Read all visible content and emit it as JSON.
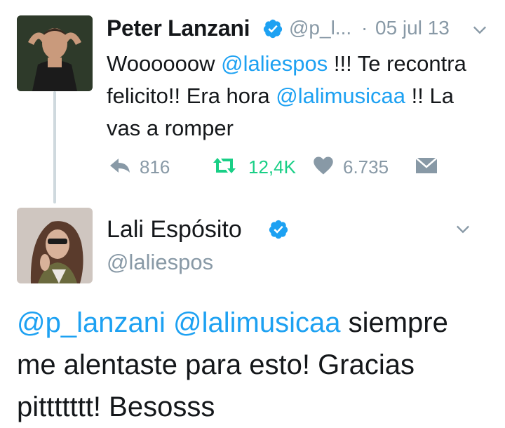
{
  "tweet1": {
    "name": "Peter Lanzani",
    "handle": "@p_l...",
    "separator": "·",
    "date": "05 jul 13",
    "text": {
      "part1": "Woooooow ",
      "mention1": "@laliespos",
      "part2": " !!! Te recontra felicito!! Era hora ",
      "mention2": "@lalimusicaa",
      "part3": " !! La vas a romper"
    },
    "actions": {
      "replies": "816",
      "retweets": "12,4K",
      "likes": "6.735"
    }
  },
  "tweet2": {
    "name": "Lali Espósito",
    "handle": "@laliespos",
    "text": {
      "mention1": "@p_lanzani",
      "mention2": "@lalimusicaa",
      "rest": " siempre me alentaste para esto! Gracias pittttttt! Besosss"
    }
  },
  "colors": {
    "link": "#1da1f2",
    "muted": "#8899a6",
    "retweet": "#19cf86",
    "verified": "#1da1f2",
    "thread_line": "#cfd9de"
  },
  "icons": [
    "verified-badge-icon",
    "chevron-down-icon",
    "reply-icon",
    "retweet-icon",
    "heart-icon",
    "envelope-icon"
  ]
}
